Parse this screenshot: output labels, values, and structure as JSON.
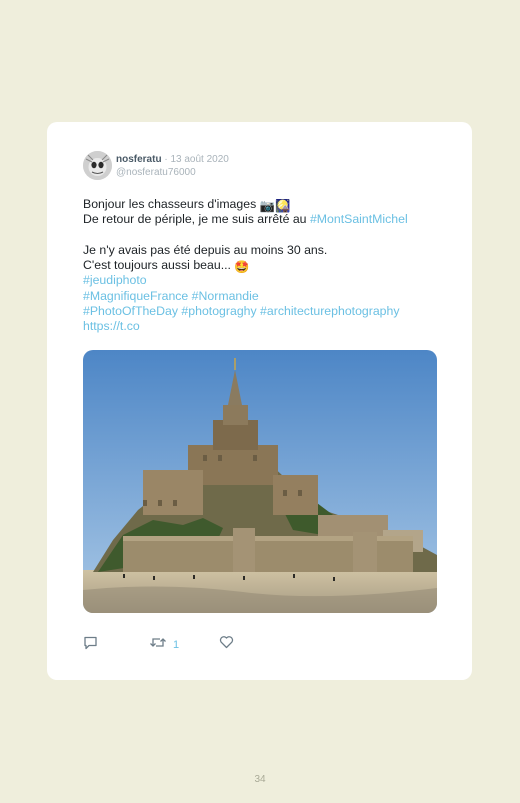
{
  "tweet": {
    "author_name": "nosferatu",
    "date": "· 13 août 2020",
    "handle": "@nosferatu76000",
    "lines": [
      {
        "parts": [
          {
            "t": "Bonjour les chasseurs d'images "
          },
          {
            "t": "📷🎑",
            "emoji": true
          }
        ]
      },
      {
        "parts": [
          {
            "t": "De retour de périple, je me suis arrêté au "
          },
          {
            "t": "#MontSaintMichel",
            "tag": true
          }
        ]
      },
      {
        "blank": true
      },
      {
        "parts": [
          {
            "t": "Je n'y avais pas été depuis au moins 30 ans."
          }
        ]
      },
      {
        "parts": [
          {
            "t": "C'est toujours aussi beau... "
          },
          {
            "t": "🤩",
            "emoji": true
          }
        ]
      },
      {
        "parts": [
          {
            "t": "#jeudiphoto",
            "tag": true
          }
        ]
      },
      {
        "parts": [
          {
            "t": "#MagnifiqueFrance #Normandie",
            "tag": true
          }
        ]
      },
      {
        "parts": [
          {
            "t": "#PhotoOfTheDay #photograghy #architecturephotography",
            "tag": true
          }
        ]
      },
      {
        "parts": [
          {
            "t": "https://t.co",
            "tag": true
          }
        ]
      }
    ],
    "retweet_count": "1",
    "icons": {
      "reply": "reply-icon",
      "retweet": "retweet-icon",
      "like": "heart-icon"
    }
  },
  "page_number": "34",
  "colors": {
    "background": "#efeedc",
    "card": "#ffffff",
    "link": "#6bc0e3",
    "muted": "#a9b3ba"
  }
}
